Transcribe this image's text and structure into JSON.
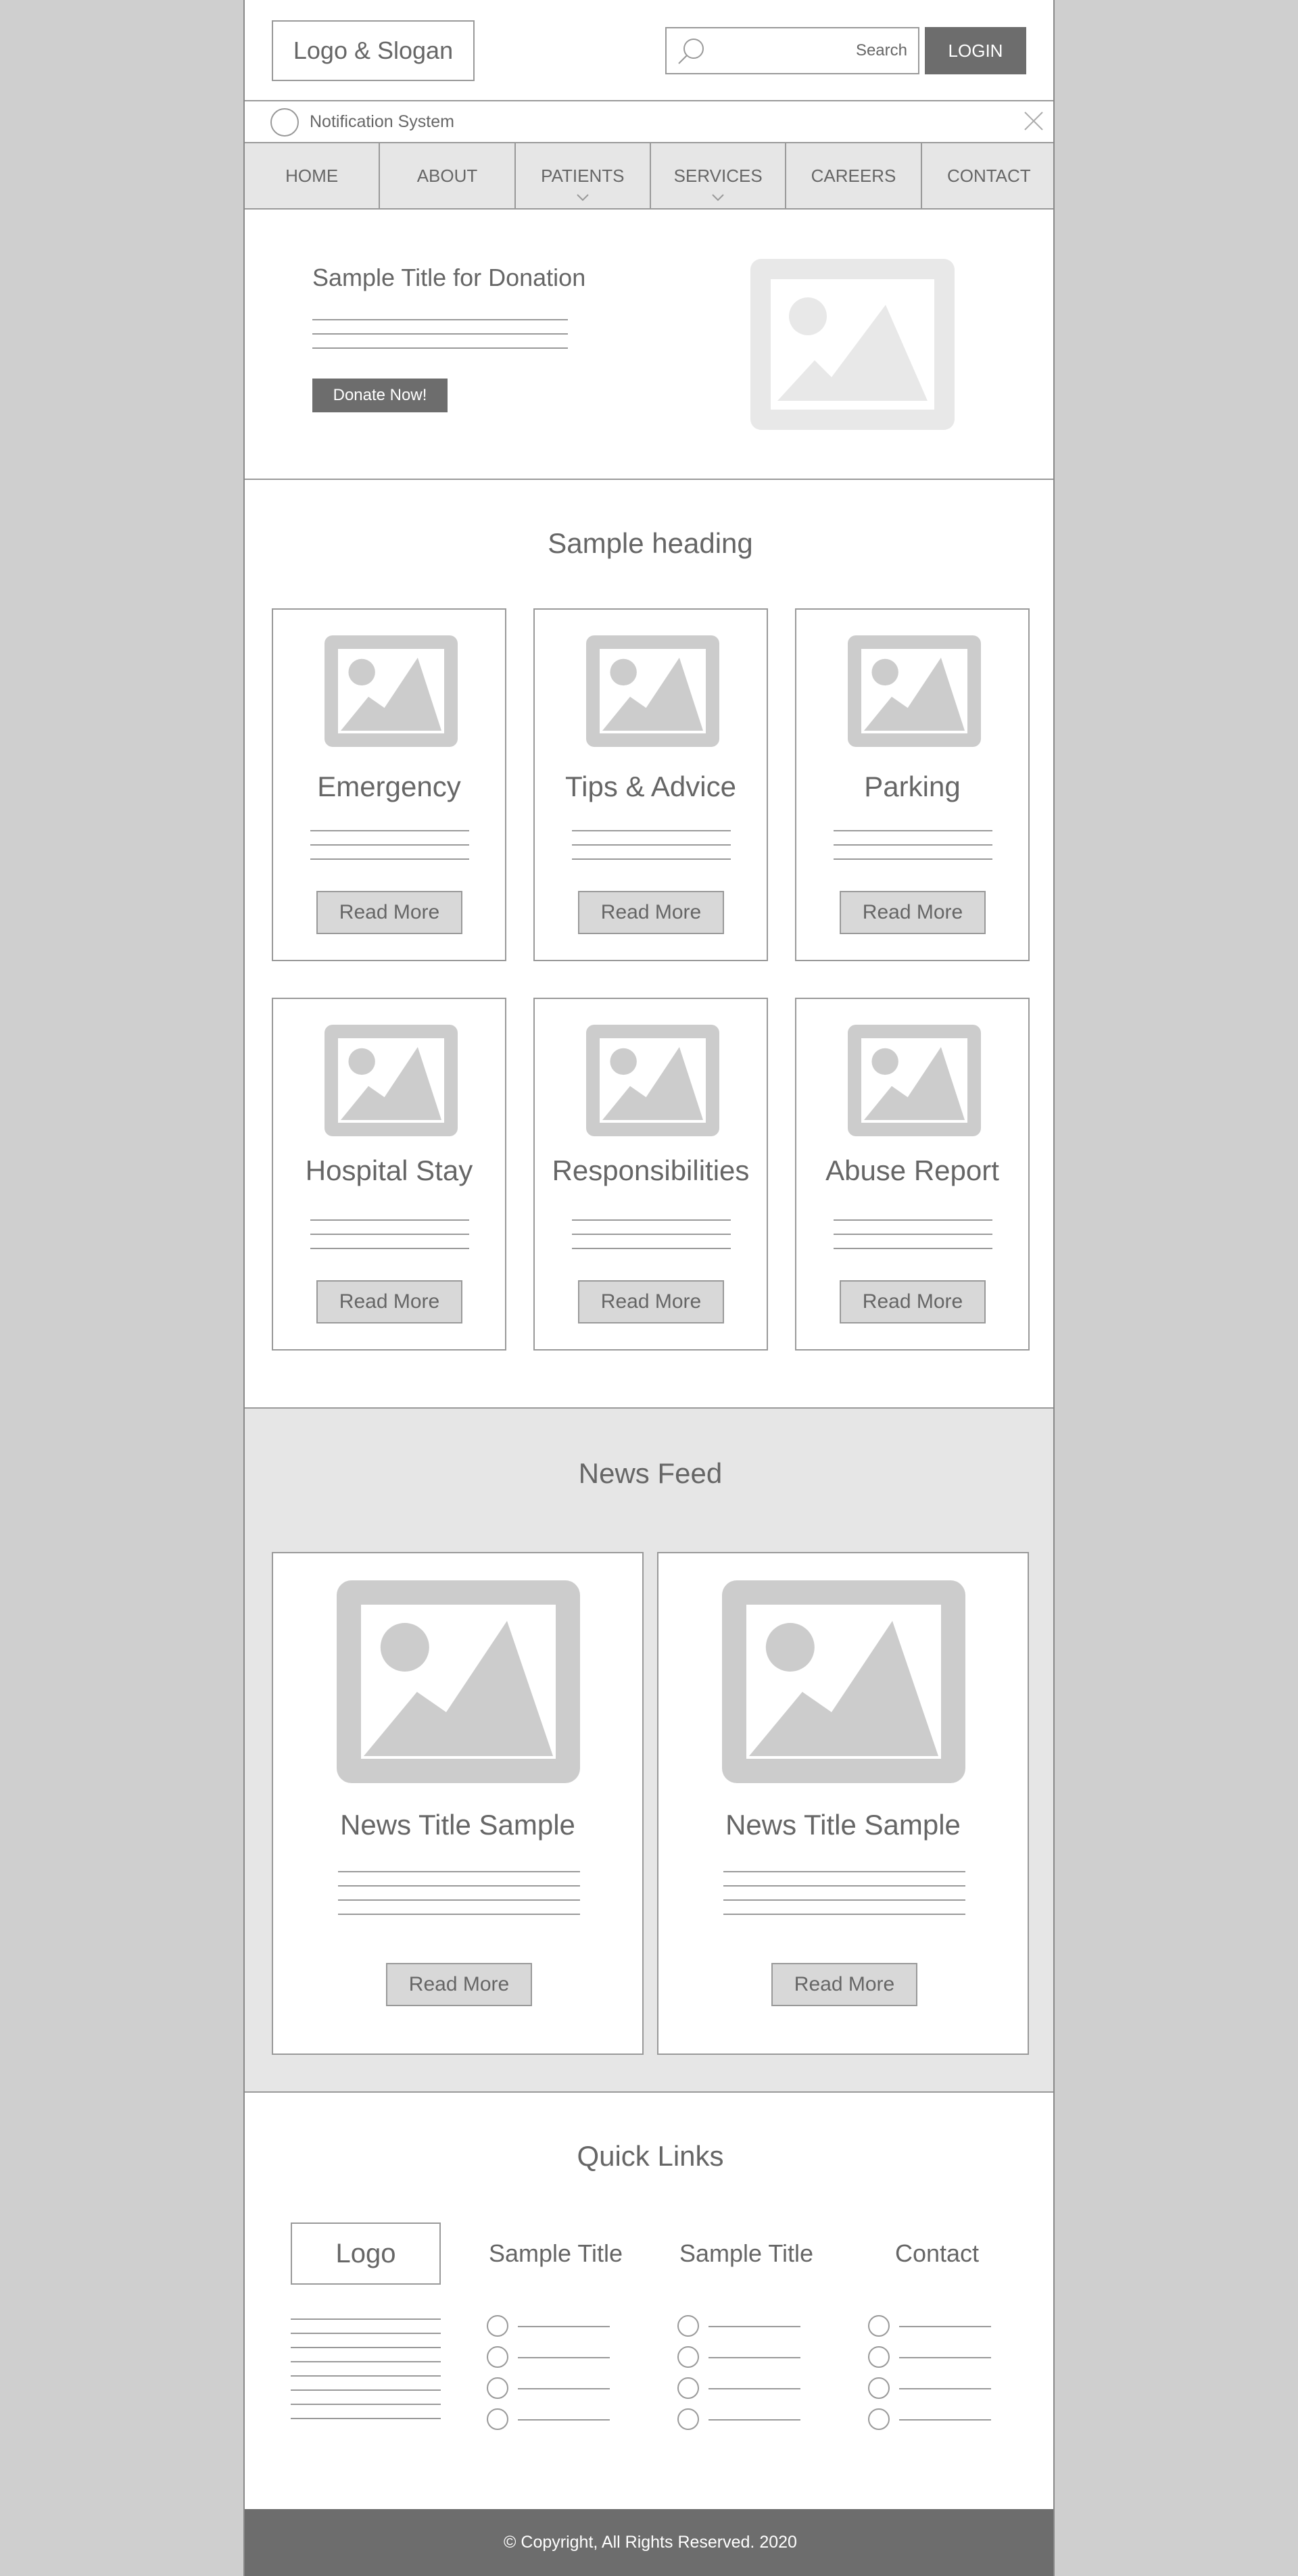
{
  "header": {
    "logo_text": "Logo & Slogan",
    "search_placeholder": "Search",
    "login_label": "LOGIN"
  },
  "notification": {
    "text": "Notification System"
  },
  "nav": {
    "home": "HOME",
    "about": "ABOUT",
    "patients": "PATIENTS",
    "services": "SERVICES",
    "careers": "CAREERS",
    "contact": "CONTACT"
  },
  "hero": {
    "title": "Sample Title for Donation",
    "donate_label": "Donate Now!"
  },
  "services": {
    "heading": "Sample heading",
    "cards": [
      {
        "title": "Emergency",
        "button": "Read More"
      },
      {
        "title": "Tips & Advice",
        "button": "Read More"
      },
      {
        "title": "Parking",
        "button": "Read More"
      },
      {
        "title": "Hospital Stay",
        "button": "Read More"
      },
      {
        "title": "Responsibilities",
        "button": "Read More"
      },
      {
        "title": "Abuse Report",
        "button": "Read More"
      }
    ]
  },
  "news": {
    "heading": "News Feed",
    "items": [
      {
        "title": "News Title Sample",
        "button": "Read More"
      },
      {
        "title": "News Title Sample",
        "button": "Read More"
      }
    ]
  },
  "quick_links": {
    "heading": "Quick Links",
    "logo_text": "Logo",
    "col1_title": "Sample Title",
    "col2_title": "Sample Title",
    "col3_title": "Contact"
  },
  "footer": {
    "copyright": "© Copyright, All Rights Reserved. 2020"
  },
  "colors": {
    "dark_gray": "#6d6d6d",
    "light_gray": "#e6e6e6",
    "border": "#999999",
    "page_bg": "#cfcfcf"
  }
}
